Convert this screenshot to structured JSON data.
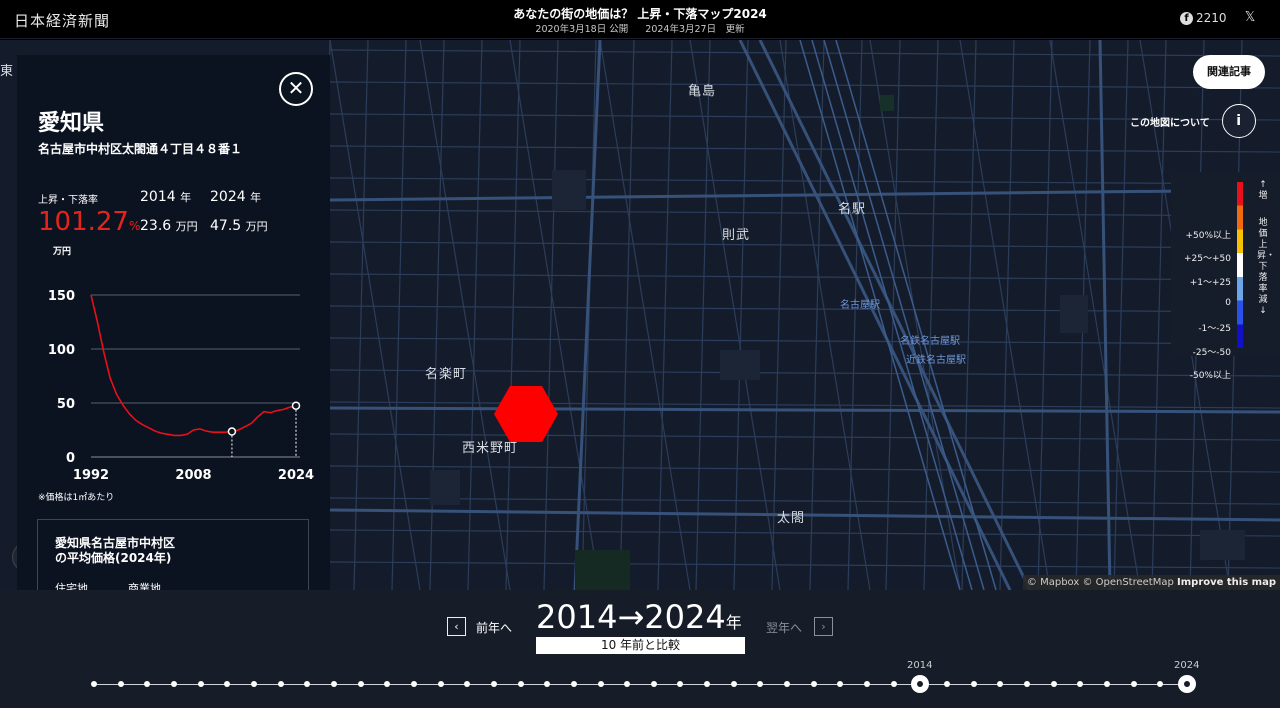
{
  "header": {
    "logo": "日本経済新聞",
    "title": "あなたの街の地価は？ 上昇・下落マップ2024",
    "published": "2020年3月18日 公開",
    "updated": "2024年3月27日　更新",
    "facebook_count": "2210",
    "facebook_icon": "facebook-icon",
    "x_icon": "x-icon"
  },
  "map": {
    "related_articles": "関連記事",
    "about_label": "この地図について",
    "about_icon": "i",
    "places": [
      "亀島",
      "名駅",
      "則武",
      "名楽町",
      "西米野町",
      "太閤",
      "東"
    ],
    "stations": [
      "名古屋駅",
      "名鉄名古屋駅",
      "近鉄名古屋駅"
    ],
    "attribution": "© Mapbox © OpenStreetMap",
    "improve": "Improve this map",
    "marker_color": "#ff0000"
  },
  "legend": {
    "rows": [
      "+50%以上",
      "+25〜+50",
      "+1〜+25",
      "0",
      "-1〜-25",
      "-25〜-50",
      "-50%以上"
    ],
    "colors": [
      "#e8101a",
      "#f06a10",
      "#f7c000",
      "#ffffff",
      "#6aa6e8",
      "#2a52e8",
      "#1010c8"
    ],
    "top_label": "増",
    "title": "地価上昇・下落率",
    "bottom_label": "減",
    "arrow_up": "↑",
    "arrow_down": "↓"
  },
  "panel": {
    "close_icon": "close-icon",
    "prefecture": "愛知県",
    "address": "名古屋市中村区太閤通４丁目４８番１",
    "rate_label": "上昇・下落率",
    "year_from": "2014",
    "year_to": "2024",
    "year_unit": "年",
    "rate_value": "101.27",
    "rate_unit": "%",
    "price_from": "23.6",
    "price_to": "47.5",
    "price_unit": "万円",
    "chart_unit": "万円",
    "note": "※価格は1㎡あたり",
    "avg_title_1": "愛知県名古屋市中村区",
    "avg_title_2": "の平均価格(2024年)",
    "avg_col1": "住宅地",
    "avg_col2": "商業地"
  },
  "chart_data": {
    "type": "line",
    "x": [
      1992,
      1993,
      1994,
      1995,
      1996,
      1997,
      1998,
      1999,
      2000,
      2001,
      2002,
      2003,
      2004,
      2005,
      2006,
      2007,
      2008,
      2009,
      2010,
      2011,
      2012,
      2013,
      2014,
      2015,
      2016,
      2017,
      2018,
      2019,
      2020,
      2021,
      2022,
      2023,
      2024
    ],
    "y": [
      150,
      125,
      97,
      73,
      58,
      48,
      40,
      34,
      30,
      27,
      24,
      22,
      21,
      20,
      20,
      21,
      25,
      26,
      24,
      23,
      23,
      23,
      23.6,
      25,
      28,
      31,
      37,
      42,
      41,
      43,
      44,
      46,
      47.5
    ],
    "ylim": [
      0,
      150
    ],
    "yticks": [
      0,
      50,
      100,
      150
    ],
    "xticks": [
      1992,
      2008,
      2024
    ],
    "highlight": [
      {
        "x": 2014,
        "y": 23.6
      },
      {
        "x": 2024,
        "y": 47.5
      }
    ],
    "color": "#e8101a",
    "grid": true
  },
  "bottom": {
    "prev_label": "前年へ",
    "next_label": "翌年へ",
    "prev_icon": "‹",
    "next_icon": "›",
    "from": "2014",
    "arrow": "→",
    "to": "2024",
    "unit": "年",
    "compare": "10 年前と比較",
    "tl_label_from": "2014",
    "tl_label_to": "2024",
    "timeline_years": [
      1983,
      1984,
      1985,
      1986,
      1987,
      1988,
      1989,
      1990,
      1991,
      1992,
      1993,
      1994,
      1995,
      1996,
      1997,
      1998,
      1999,
      2000,
      2001,
      2002,
      2003,
      2004,
      2005,
      2006,
      2007,
      2008,
      2009,
      2010,
      2011,
      2012,
      2013,
      2014,
      2015,
      2016,
      2017,
      2018,
      2019,
      2020,
      2021,
      2022,
      2023,
      2024
    ],
    "selected": [
      2014,
      2024
    ]
  }
}
